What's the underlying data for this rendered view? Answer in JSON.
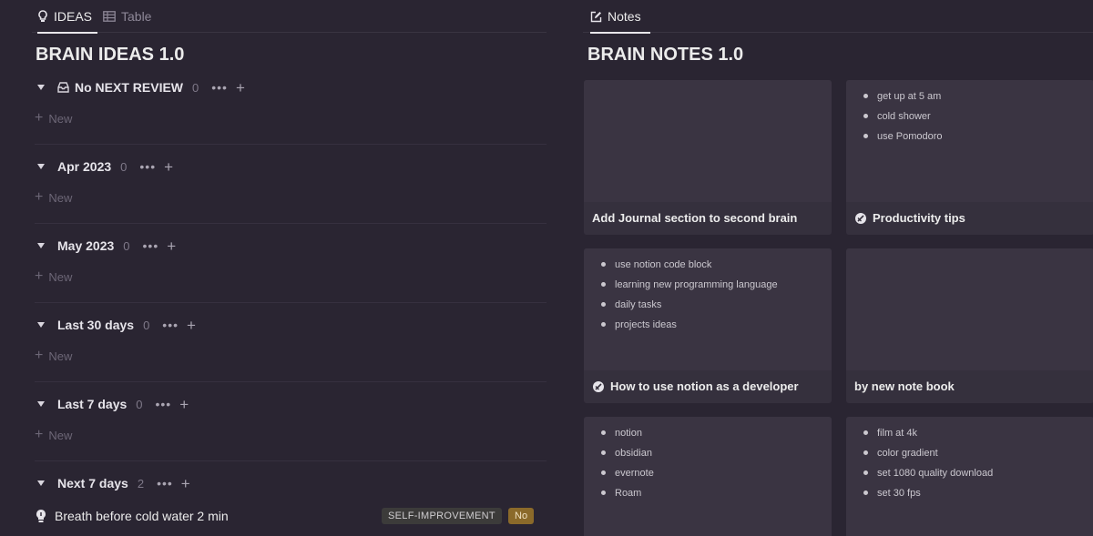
{
  "left": {
    "tabs": [
      {
        "label": "IDEAS",
        "icon": "lightbulb-icon",
        "active": true
      },
      {
        "label": "Table",
        "icon": "table-icon",
        "active": false
      }
    ],
    "title": "BRAIN IDEAS 1.0",
    "groups": [
      {
        "title": "No NEXT REVIEW",
        "count": "0",
        "icon": "inbox-icon",
        "new_label": "New"
      },
      {
        "title": "Apr 2023",
        "count": "0",
        "new_label": "New"
      },
      {
        "title": "May 2023",
        "count": "0",
        "new_label": "New"
      },
      {
        "title": "Last 30 days",
        "count": "0",
        "new_label": "New"
      },
      {
        "title": "Last 7 days",
        "count": "0",
        "new_label": "New"
      },
      {
        "title": "Next 7 days",
        "count": "2"
      }
    ],
    "more_label": "•••",
    "plus_label": "+",
    "items": [
      {
        "title": "Breath before cold water 2 min",
        "tag": "SELF-IMPROVEMENT",
        "status": "No"
      }
    ]
  },
  "right": {
    "tabs": [
      {
        "label": "Notes",
        "icon": "edit-icon",
        "active": true
      }
    ],
    "title": "BRAIN NOTES 1.0",
    "cards": [
      {
        "title": "Add Journal section to second brain",
        "bullets": []
      },
      {
        "title": "Productivity tips",
        "icon": "notion-logo-icon",
        "bullets": [
          "get up at 5 am",
          "cold shower",
          "use Pomodoro"
        ]
      },
      {
        "title": "How to use notion as a developer",
        "icon": "notion-logo-icon",
        "bullets": [
          "use notion code block",
          "learning new programming language",
          "daily tasks",
          "projects ideas"
        ]
      },
      {
        "title": "by new note book",
        "bullets": []
      },
      {
        "title": "",
        "bullets": [
          "notion",
          "obsidian",
          "evernote",
          "Roam"
        ]
      },
      {
        "title": "",
        "bullets": [
          "film at 4k",
          "color gradient",
          "set 1080 quality download",
          "set 30 fps"
        ]
      }
    ]
  },
  "colors": {
    "background": "#2a2532",
    "card": "#35303d",
    "tag_no": "#8b6a2a",
    "tag_self": "#3c3b3a"
  }
}
